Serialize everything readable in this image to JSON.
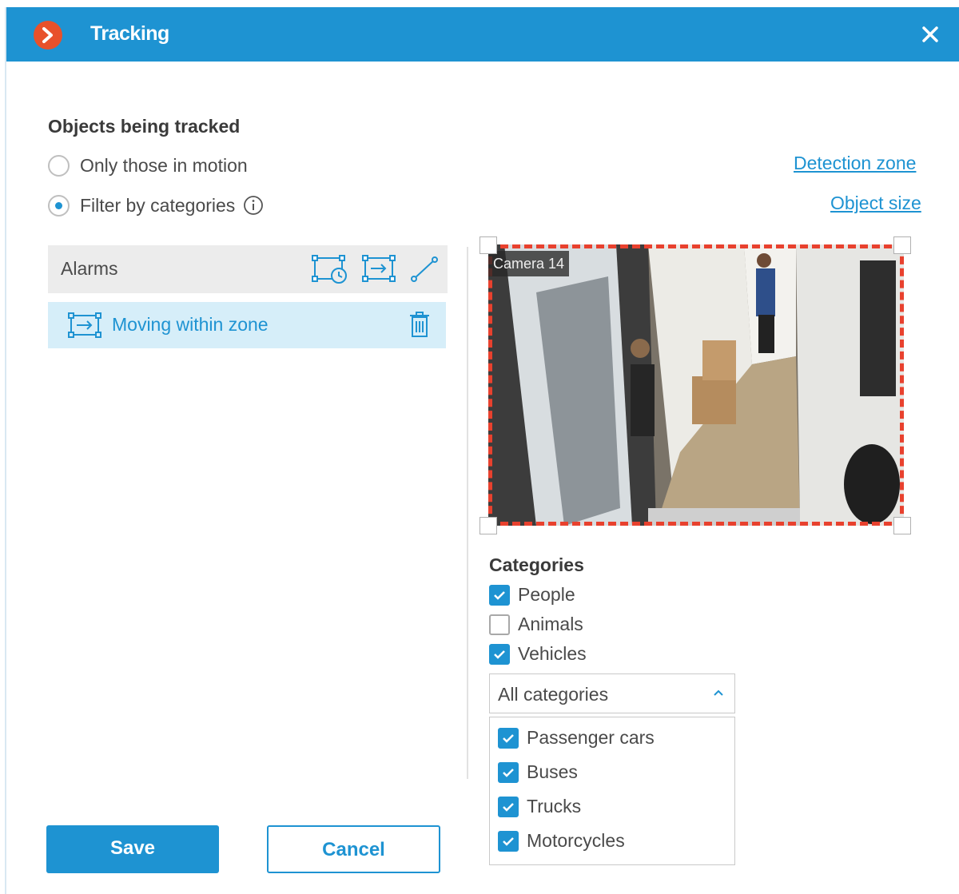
{
  "window": {
    "title": "Tracking",
    "accent_color": "#1e93d2",
    "logo_icon": "chevron-right-circle-logo",
    "close_icon": "close-icon"
  },
  "objects": {
    "section_title": "Objects being tracked",
    "options": [
      {
        "label": "Only those in motion",
        "selected": false
      },
      {
        "label": "Filter by categories",
        "selected": true
      }
    ],
    "info_icon": "info-icon"
  },
  "links": {
    "detection_zone": "Detection zone",
    "object_size": "Object size"
  },
  "alarms": {
    "header": "Alarms",
    "header_icons": [
      "zone-timer-icon",
      "zone-enter-icon",
      "line-cross-icon"
    ],
    "items": [
      {
        "label": "Moving within zone",
        "icon": "zone-enter-icon",
        "delete_icon": "trash-icon"
      }
    ]
  },
  "preview": {
    "camera_label": "Camera 14",
    "zone_color": "#e8412e"
  },
  "categories": {
    "title": "Categories",
    "items": [
      {
        "label": "People",
        "checked": true
      },
      {
        "label": "Animals",
        "checked": false
      },
      {
        "label": "Vehicles",
        "checked": true
      }
    ],
    "select_value": "All categories",
    "subcategories": [
      {
        "label": "Passenger cars",
        "checked": true
      },
      {
        "label": "Buses",
        "checked": true
      },
      {
        "label": "Trucks",
        "checked": true
      },
      {
        "label": "Motorcycles",
        "checked": true
      }
    ]
  },
  "buttons": {
    "save": "Save",
    "cancel": "Cancel"
  }
}
